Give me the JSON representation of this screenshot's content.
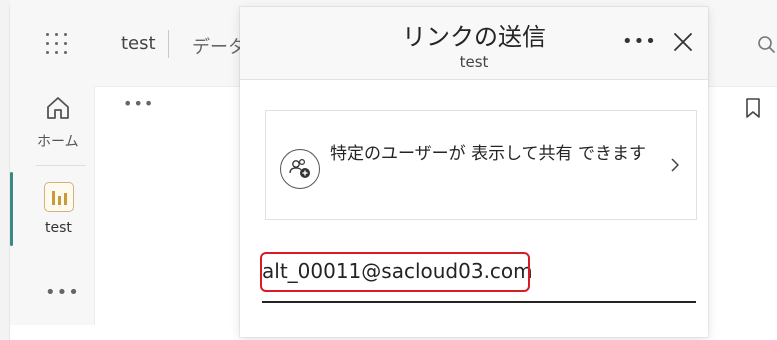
{
  "app": {
    "breadcrumb_first": "test",
    "breadcrumb_second": "データ",
    "rail_home_label": "ホーム",
    "rail_app_label": "test",
    "more_glyph": "•••",
    "accent": "#3a8a83"
  },
  "dialog": {
    "title": "リンクの送信",
    "subtitle": "test",
    "more_glyph": "•••",
    "sharing_text": "特定のユーザーが 表示して共有 できます",
    "email_value": "alt_00011@sacloud03.com",
    "highlight_color": "#d81c26"
  },
  "icons": {
    "waffle": "app-launcher-icon",
    "home": "home-icon",
    "app": "bar-chart-app-icon",
    "search": "search-icon",
    "bookmark": "bookmark-icon",
    "close": "close-icon",
    "people": "people-add-icon",
    "chevron": "chevron-right-icon"
  }
}
